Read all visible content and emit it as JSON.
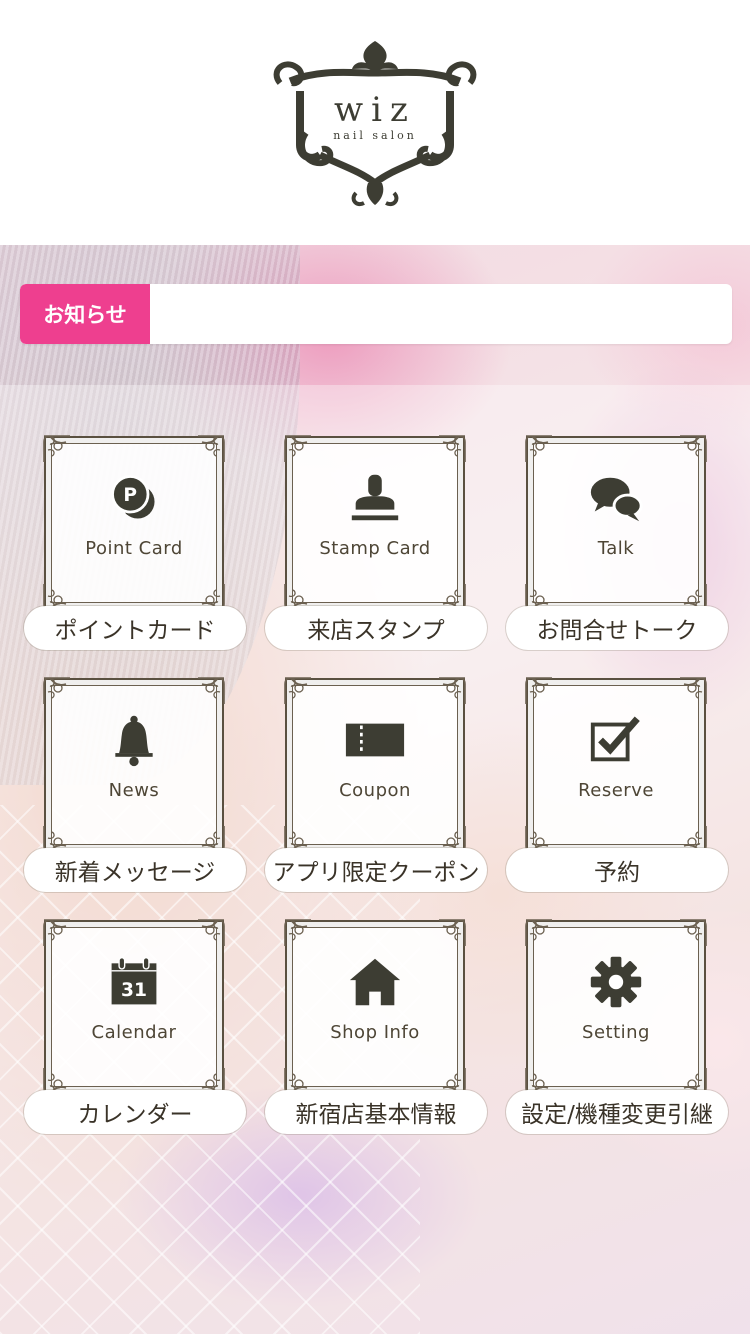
{
  "app": {
    "logo": {
      "brand": "wiz",
      "tagline": "nail salon"
    }
  },
  "notice": {
    "label": "お知らせ",
    "message": ""
  },
  "colors": {
    "accent": "#ee3f8f",
    "icon": "#3d3d33",
    "frame": "#5a5040"
  },
  "menu": [
    {
      "en": "Point Card",
      "jp": "ポイントカード",
      "icon": "point-card-icon"
    },
    {
      "en": "Stamp Card",
      "jp": "来店スタンプ",
      "icon": "stamp-icon"
    },
    {
      "en": "Talk",
      "jp": "お問合せトーク",
      "icon": "chat-bubbles-icon"
    },
    {
      "en": "News",
      "jp": "新着メッセージ",
      "icon": "bell-icon"
    },
    {
      "en": "Coupon",
      "jp": "アプリ限定クーポン",
      "icon": "coupon-icon"
    },
    {
      "en": "Reserve",
      "jp": "予約",
      "icon": "checkbox-icon"
    },
    {
      "en": "Calendar",
      "jp": "カレンダー",
      "icon": "calendar-icon",
      "date": "31"
    },
    {
      "en": "Shop Info",
      "jp": "新宿店基本情報",
      "icon": "home-icon"
    },
    {
      "en": "Setting",
      "jp": "設定/機種変更引継",
      "icon": "gear-icon"
    }
  ]
}
